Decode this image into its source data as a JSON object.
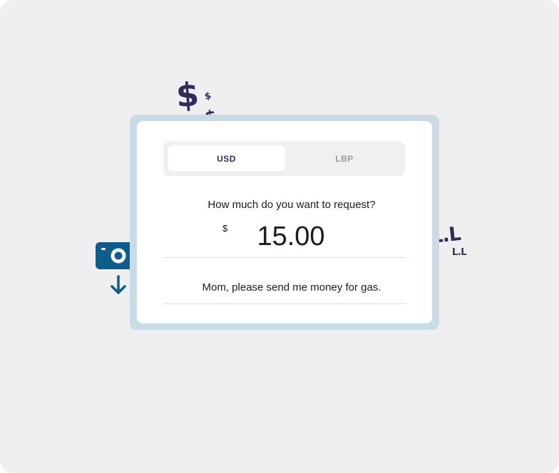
{
  "decorations": {
    "usd_symbol": "$",
    "lbp_symbol": "L.L",
    "money_icon": "cash-request-icon",
    "accent_color": "#2e2d5c",
    "money_icon_color": "#0d5c8c"
  },
  "currency_toggle": {
    "options": [
      "USD",
      "LBP"
    ],
    "selected": "USD"
  },
  "request_form": {
    "question": "How much do you want to request?",
    "currency_symbol": "$",
    "amount": "15.00",
    "note": "Mom, please send me money for gas."
  }
}
